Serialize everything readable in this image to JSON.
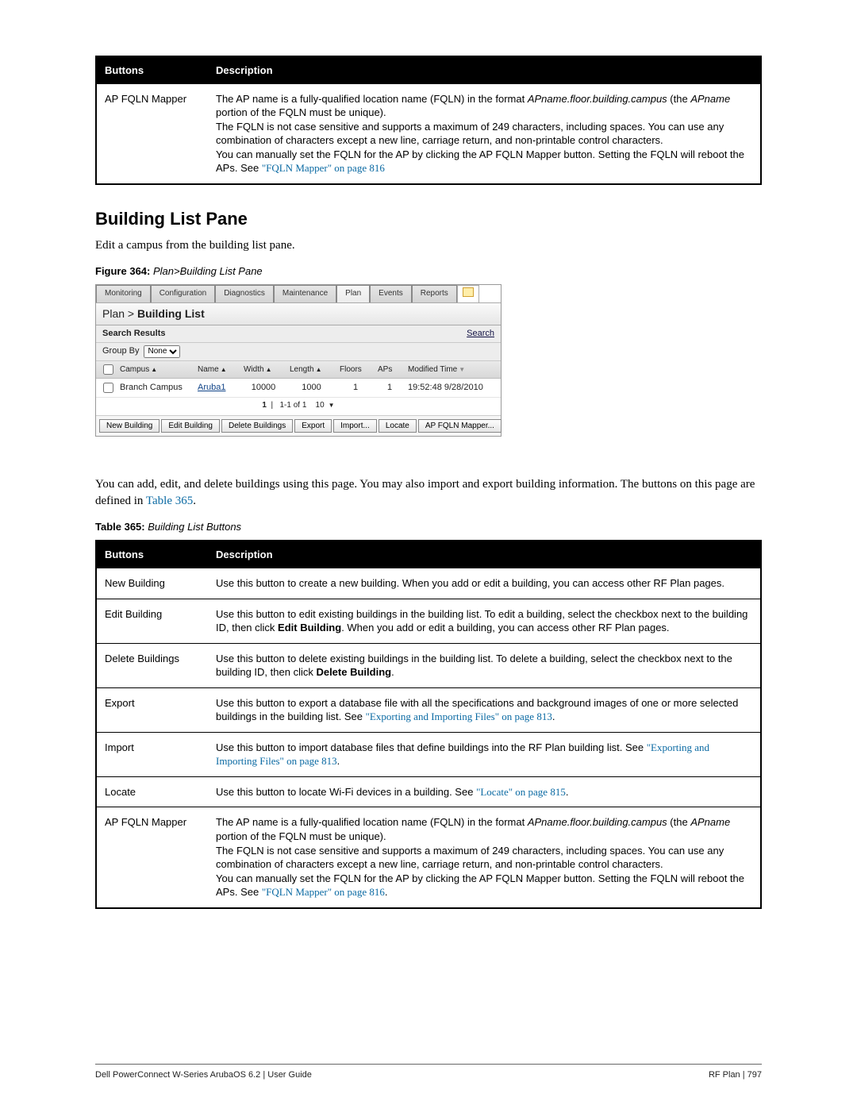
{
  "table364": {
    "head_buttons": "Buttons",
    "head_desc": "Description",
    "row_button": "AP FQLN Mapper",
    "desc_part1": "The AP name is a fully-qualified location name (FQLN) in the format ",
    "desc_italic1": "APname.floor.building.campus",
    "desc_part2": " (the ",
    "desc_italic2": "APname",
    "desc_part3": " portion of the FQLN must be unique).",
    "desc_p2": "The FQLN is not case sensitive and supports a maximum of 249 characters, including spaces. You can use any combination of characters except a new line, carriage return, and non-printable control characters.",
    "desc_p3a": "You can manually set the FQLN for the AP by clicking the AP FQLN Mapper button. Setting the FQLN will reboot the APs. See ",
    "desc_p3_link": "\"FQLN Mapper\" on page 816"
  },
  "section": {
    "heading": "Building List Pane",
    "intro": "Edit a campus from the building list pane.",
    "fig_bold": "Figure 364:",
    "fig_ital": "Plan>Building List Pane"
  },
  "shot": {
    "tabs": [
      "Monitoring",
      "Configuration",
      "Diagnostics",
      "Maintenance",
      "Plan",
      "Events",
      "Reports"
    ],
    "title_pre": "Plan > ",
    "title_bold": "Building List",
    "sr_label": "Search Results",
    "sr_link": "Search",
    "gb_label": "Group By",
    "gb_value": "None",
    "cols": {
      "campus": "Campus",
      "name": "Name",
      "width": "Width",
      "length": "Length",
      "floors": "Floors",
      "aps": "APs",
      "modified": "Modified Time"
    },
    "row": {
      "campus": "Branch Campus",
      "name": "Aruba1",
      "width": "10000",
      "length": "1000",
      "floors": "1",
      "aps": "1",
      "modified": "19:52:48 9/28/2010"
    },
    "pager_a": "1",
    "pager_b": "1-1 of 1",
    "pager_c": "10",
    "buttons": [
      "New Building",
      "Edit Building",
      "Delete Buildings",
      "Export",
      "Import...",
      "Locate",
      "AP FQLN Mapper..."
    ]
  },
  "mid_text": {
    "p1a": "You can add, edit, and delete buildings using this page. You may also import and export building information. The buttons on this page are defined in ",
    "p1_link": "Table 365",
    "p1b": ".",
    "tbl_bold": "Table 365:",
    "tbl_ital": "Building List Buttons"
  },
  "table365": {
    "head_buttons": "Buttons",
    "head_desc": "Description",
    "rows": {
      "new": {
        "label": "New Building",
        "text": "Use this button to create a new building. When you add or edit a building, you can access other RF Plan pages."
      },
      "edit": {
        "label": "Edit Building",
        "text1": "Use this button to edit existing buildings in the building list. To edit a building, select the checkbox next to the building ID, then click ",
        "bold": "Edit Building",
        "text2": ". When you add or edit a building, you can access other RF Plan pages."
      },
      "delete": {
        "label": "Delete Buildings",
        "text1": "Use this button to delete existing buildings in the building list. To delete a building, select the checkbox next to the building ID, then click ",
        "bold": "Delete Building",
        "text2": "."
      },
      "export": {
        "label": "Export",
        "text1": "Use this button to export a database file with all the specifications and background images of one or more selected buildings in the building list. See ",
        "link": "\"Exporting and Importing Files\" on page 813",
        "text2": "."
      },
      "import": {
        "label": "Import",
        "text1": "Use this button to import database files that define buildings into the RF Plan building list. See ",
        "link": "\"Exporting and Importing Files\" on page 813",
        "text2": "."
      },
      "locate": {
        "label": "Locate",
        "text1": "Use this button to locate Wi-Fi devices in a building. See ",
        "link": "\"Locate\" on page 815",
        "text2": "."
      },
      "mapper": {
        "label": "AP FQLN Mapper",
        "text1a": "The AP name is a fully-qualified location name (FQLN) in the format ",
        "ital1": "APname.floor.building.campus",
        "text1b": " (the ",
        "ital2": "APname",
        "text1c": " portion of the FQLN must be unique).",
        "p2": "The FQLN is not case sensitive and supports a maximum of 249 characters, including spaces. You can use any combination of characters except a new line, carriage return, and non-printable control characters.",
        "p3a": "You can manually set the FQLN for the AP by clicking the AP FQLN Mapper button. Setting the FQLN will reboot the APs. See ",
        "p3_link": "\"FQLN Mapper\" on page 816",
        "p3b": "."
      }
    }
  },
  "footer": {
    "left": "Dell PowerConnect W-Series ArubaOS 6.2   |   User Guide",
    "right": "RF Plan  |  797"
  }
}
